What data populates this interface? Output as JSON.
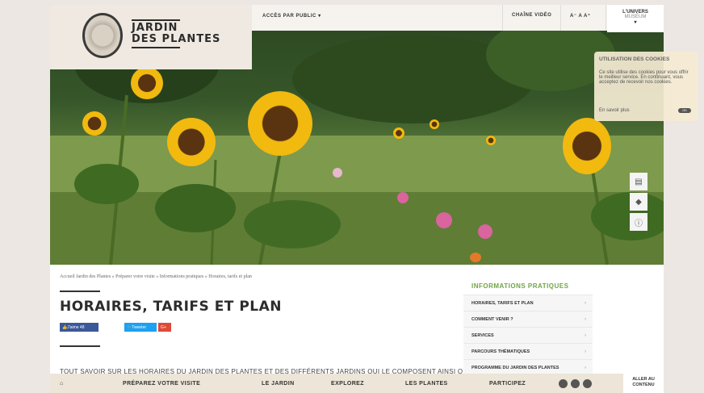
{
  "brand": {
    "line1": "JARDIN",
    "line2": "DES PLANTES"
  },
  "topnav": {
    "acces": "ACCÈS PAR PUBLIC",
    "chaine": "CHAÎNE VIDÉO",
    "font_sizes": "A⁻ A A⁺",
    "univers_line1": "L'UNIVERS",
    "univers_line2": "MUSÉUM"
  },
  "cookie": {
    "title": "UTILISATION DES COOKIES",
    "text": "Ce site utilise des cookies pour vous offrir le meilleur service. En continuant, vous acceptez de recevoir nos cookies.",
    "more": "En savoir plus",
    "ok": "OK"
  },
  "breadcrumb": "Accueil Jardin des Plantes  »  Préparer votre visite  »  Informations pratiques  »  Horaires, tarifs et plan",
  "page_title": "HORAIRES, TARIFS ET PLAN",
  "social": {
    "like": "J'aime 48",
    "tweet": "Tweeter",
    "gplus": "G+"
  },
  "intro": "TOUT SAVOIR SUR LES HORAIRES DU JARDIN DES PLANTES ET DES DIFFÉRENTS JARDINS QUI LE COMPOSENT AINSI QUE",
  "sidebar": {
    "heading": "INFORMATIONS PRATIQUES",
    "items": [
      {
        "label": "HORAIRES, TARIFS ET PLAN"
      },
      {
        "label": "COMMENT VENIR ?"
      },
      {
        "label": "SERVICES"
      },
      {
        "label": "PARCOURS THÉMATIQUES"
      },
      {
        "label": "PROGRAMME DU JARDIN DES PLANTES"
      }
    ]
  },
  "bottom_nav": {
    "preparez": "PRÉPAREZ VOTRE VISITE",
    "jardin": "LE JARDIN",
    "explorez": "EXPLOREZ",
    "plantes": "LES PLANTES",
    "participez": "PARTICIPEZ",
    "aller1": "ALLER AU",
    "aller2": "CONTENU"
  },
  "colors": {
    "accent_green": "#6fa544",
    "facebook": "#3b5998",
    "twitter": "#1da1f2",
    "gplus": "#dd4b39"
  }
}
